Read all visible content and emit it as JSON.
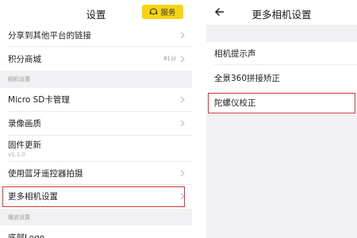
{
  "left": {
    "title": "设置",
    "service_button": "服务",
    "items": [
      {
        "label": "分享到其他平台的链接"
      },
      {
        "label": "积分商城",
        "value": "81分"
      },
      {
        "section": "相机设置"
      },
      {
        "label": "Micro SD卡管理"
      },
      {
        "label": "录像画质"
      },
      {
        "label": "固件更新",
        "sub": "v1.1.0"
      },
      {
        "label": "使用蓝牙遥控器拍摄"
      },
      {
        "label": "更多相机设置"
      },
      {
        "section": "播放设置"
      },
      {
        "label": "底部Logo"
      }
    ]
  },
  "right": {
    "title": "更多相机设置",
    "items": [
      {
        "label": "相机提示声"
      },
      {
        "label": "全景360拼接矫正"
      },
      {
        "label": "陀螺仪校正"
      }
    ]
  },
  "colors": {
    "accent_yellow": "#f7d40f",
    "highlight_red": "#d6333a",
    "section_bg": "#f1f1f3"
  }
}
